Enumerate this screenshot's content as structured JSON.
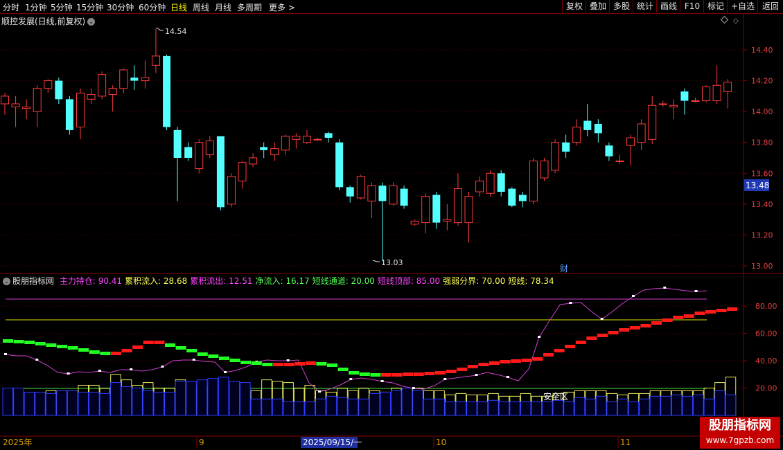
{
  "toolbar": {
    "periods": [
      "分时",
      "1分钟",
      "5分钟",
      "15分钟",
      "30分钟",
      "60分钟",
      "日线",
      "周线",
      "月线",
      "多周期",
      "更多 >"
    ],
    "active_period": "日线",
    "right_buttons": [
      "复权",
      "叠加",
      "多股",
      "统计",
      "画线",
      "F10",
      "标记",
      "+自选",
      "返回"
    ]
  },
  "chart_title": "顺控发展(日线,前复权)",
  "price_axis": {
    "ticks": [
      "14.40",
      "14.20",
      "14.00",
      "13.80",
      "13.60",
      "13.40",
      "13.20",
      "13.00"
    ],
    "current": "13.48"
  },
  "annotations": {
    "high": "14.54",
    "low": "13.03",
    "cai": "财",
    "safe_zone": "安全区"
  },
  "indicator": {
    "name": "股朋指标网",
    "items": [
      {
        "label": "主力持仓: 90.41",
        "color": "#ff44ff"
      },
      {
        "label": "累积流入: 28.68",
        "color": "#ffff55"
      },
      {
        "label": "累积流出: 12.51",
        "color": "#ff44ff"
      },
      {
        "label": "净流入: 16.17",
        "color": "#55ff55"
      },
      {
        "label": "短线通道: 20.00",
        "color": "#55ff55"
      },
      {
        "label": "短线顶部: 85.00",
        "color": "#ff44ff"
      },
      {
        "label": "强弱分界: 70.00",
        "color": "#ffff55"
      },
      {
        "label": "短线: 78.34",
        "color": "#ffff55"
      }
    ],
    "axis": [
      "80.00",
      "60.00",
      "40.00",
      "20.00"
    ]
  },
  "date_axis": {
    "labels": [
      "2025年",
      "9",
      "2025/09/15/一",
      "10",
      "11"
    ]
  },
  "logo": {
    "line1": "股朋指标网",
    "line2": "www.7gpzb.com"
  },
  "chart_data": {
    "type": "candlestick",
    "title": "顺控发展(日线,前复权)",
    "ylim": [
      12.98,
      14.56
    ],
    "high_label": 14.54,
    "low_label": 13.03,
    "current_price": 13.48,
    "candles": [
      {
        "o": 14.05,
        "c": 14.1,
        "h": 14.12,
        "l": 13.98
      },
      {
        "o": 14.03,
        "c": 14.05,
        "h": 14.1,
        "l": 13.9
      },
      {
        "o": 14.02,
        "c": 14.03,
        "h": 14.08,
        "l": 13.95
      },
      {
        "o": 14.0,
        "c": 14.15,
        "h": 14.17,
        "l": 13.9
      },
      {
        "o": 14.15,
        "c": 14.2,
        "h": 14.21,
        "l": 14.12
      },
      {
        "o": 14.2,
        "c": 14.08,
        "h": 14.22,
        "l": 14.05
      },
      {
        "o": 14.08,
        "c": 13.88,
        "h": 14.1,
        "l": 13.85
      },
      {
        "o": 13.9,
        "c": 14.12,
        "h": 14.15,
        "l": 13.82
      },
      {
        "o": 14.08,
        "c": 14.11,
        "h": 14.15,
        "l": 14.05
      },
      {
        "o": 14.1,
        "c": 14.24,
        "h": 14.26,
        "l": 14.08
      },
      {
        "o": 14.11,
        "c": 14.15,
        "h": 14.17,
        "l": 14.0
      },
      {
        "o": 14.15,
        "c": 14.27,
        "h": 14.28,
        "l": 14.12
      },
      {
        "o": 14.22,
        "c": 14.2,
        "h": 14.3,
        "l": 14.14
      },
      {
        "o": 14.2,
        "c": 14.22,
        "h": 14.33,
        "l": 14.15
      },
      {
        "o": 14.3,
        "c": 14.36,
        "h": 14.54,
        "l": 14.25
      },
      {
        "o": 14.36,
        "c": 13.9,
        "h": 14.37,
        "l": 13.88
      },
      {
        "o": 13.88,
        "c": 13.7,
        "h": 13.9,
        "l": 13.42
      },
      {
        "o": 13.77,
        "c": 13.7,
        "h": 13.8,
        "l": 13.68
      },
      {
        "o": 13.63,
        "c": 13.8,
        "h": 13.82,
        "l": 13.6
      },
      {
        "o": 13.72,
        "c": 13.81,
        "h": 13.84,
        "l": 13.7
      },
      {
        "o": 13.84,
        "c": 13.38,
        "h": 13.84,
        "l": 13.36
      },
      {
        "o": 13.4,
        "c": 13.58,
        "h": 13.6,
        "l": 13.38
      },
      {
        "o": 13.55,
        "c": 13.67,
        "h": 13.68,
        "l": 13.5
      },
      {
        "o": 13.66,
        "c": 13.7,
        "h": 13.73,
        "l": 13.64
      },
      {
        "o": 13.77,
        "c": 13.75,
        "h": 13.8,
        "l": 13.7
      },
      {
        "o": 13.72,
        "c": 13.76,
        "h": 13.8,
        "l": 13.68
      },
      {
        "o": 13.75,
        "c": 13.84,
        "h": 13.85,
        "l": 13.72
      },
      {
        "o": 13.82,
        "c": 13.84,
        "h": 13.86,
        "l": 13.76
      },
      {
        "o": 13.8,
        "c": 13.84,
        "h": 13.88,
        "l": 13.79
      },
      {
        "o": 13.82,
        "c": 13.82,
        "h": 13.83,
        "l": 13.81
      },
      {
        "o": 13.86,
        "c": 13.83,
        "h": 13.87,
        "l": 13.8
      },
      {
        "o": 13.8,
        "c": 13.51,
        "h": 13.82,
        "l": 13.49
      },
      {
        "o": 13.51,
        "c": 13.45,
        "h": 13.52,
        "l": 13.41
      },
      {
        "o": 13.44,
        "c": 13.58,
        "h": 13.59,
        "l": 13.43
      },
      {
        "o": 13.42,
        "c": 13.52,
        "h": 13.54,
        "l": 13.31
      },
      {
        "o": 13.52,
        "c": 13.42,
        "h": 13.54,
        "l": 13.03
      },
      {
        "o": 13.4,
        "c": 13.52,
        "h": 13.54,
        "l": 13.39
      },
      {
        "o": 13.5,
        "c": 13.39,
        "h": 13.52,
        "l": 13.37
      },
      {
        "o": 13.27,
        "c": 13.29,
        "h": 13.3,
        "l": 13.26
      },
      {
        "o": 13.28,
        "c": 13.45,
        "h": 13.47,
        "l": 13.21
      },
      {
        "o": 13.46,
        "c": 13.28,
        "h": 13.48,
        "l": 13.24
      },
      {
        "o": 13.29,
        "c": 13.3,
        "h": 13.4,
        "l": 13.23
      },
      {
        "o": 13.28,
        "c": 13.5,
        "h": 13.6,
        "l": 13.26
      },
      {
        "o": 13.28,
        "c": 13.45,
        "h": 13.48,
        "l": 13.15
      },
      {
        "o": 13.48,
        "c": 13.55,
        "h": 13.58,
        "l": 13.45
      },
      {
        "o": 13.47,
        "c": 13.6,
        "h": 13.62,
        "l": 13.45
      },
      {
        "o": 13.6,
        "c": 13.48,
        "h": 13.62,
        "l": 13.45
      },
      {
        "o": 13.5,
        "c": 13.39,
        "h": 13.51,
        "l": 13.38
      },
      {
        "o": 13.46,
        "c": 13.42,
        "h": 13.48,
        "l": 13.38
      },
      {
        "o": 13.42,
        "c": 13.68,
        "h": 13.7,
        "l": 13.4
      },
      {
        "o": 13.57,
        "c": 13.68,
        "h": 13.7,
        "l": 13.55
      },
      {
        "o": 13.62,
        "c": 13.8,
        "h": 13.82,
        "l": 13.6
      },
      {
        "o": 13.8,
        "c": 13.74,
        "h": 13.85,
        "l": 13.7
      },
      {
        "o": 13.8,
        "c": 13.9,
        "h": 13.95,
        "l": 13.78
      },
      {
        "o": 13.94,
        "c": 13.88,
        "h": 14.05,
        "l": 13.84
      },
      {
        "o": 13.92,
        "c": 13.86,
        "h": 13.95,
        "l": 13.8
      },
      {
        "o": 13.78,
        "c": 13.71,
        "h": 13.8,
        "l": 13.68
      },
      {
        "o": 13.68,
        "c": 13.68,
        "h": 13.72,
        "l": 13.66
      },
      {
        "o": 13.78,
        "c": 13.83,
        "h": 13.85,
        "l": 13.65
      },
      {
        "o": 13.8,
        "c": 13.92,
        "h": 13.95,
        "l": 13.75
      },
      {
        "o": 13.82,
        "c": 14.04,
        "h": 14.1,
        "l": 13.79
      },
      {
        "o": 14.05,
        "c": 14.05,
        "h": 14.07,
        "l": 14.03
      },
      {
        "o": 14.03,
        "c": 14.04,
        "h": 14.08,
        "l": 13.95
      },
      {
        "o": 14.13,
        "c": 14.07,
        "h": 14.15,
        "l": 13.98
      },
      {
        "o": 14.07,
        "c": 14.07,
        "h": 14.09,
        "l": 14.06
      },
      {
        "o": 14.07,
        "c": 14.16,
        "h": 14.17,
        "l": 14.06
      },
      {
        "o": 14.07,
        "c": 14.17,
        "h": 14.3,
        "l": 14.05
      },
      {
        "o": 14.13,
        "c": 14.19,
        "h": 14.21,
        "l": 14.02
      }
    ]
  }
}
